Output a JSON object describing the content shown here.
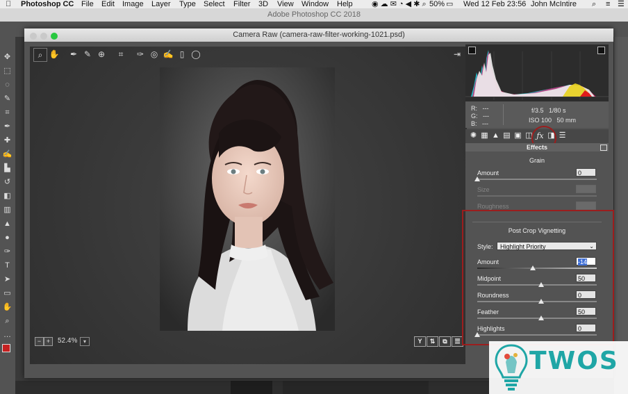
{
  "menubar": {
    "app": "Photoshop CC",
    "items": [
      "File",
      "Edit",
      "Image",
      "Layer",
      "Type",
      "Select",
      "Filter",
      "3D",
      "View",
      "Window",
      "Help"
    ],
    "battery": "50%",
    "datetime": "Wed 12 Feb  23:56",
    "user": "John McIntire"
  },
  "photoshop": {
    "title": "Adobe Photoshop CC 2018"
  },
  "camera_raw": {
    "title": "Camera Raw (camera-raw-filter-working-1021.psd)",
    "tools": [
      "zoom-icon",
      "hand-icon",
      "white-balance-icon",
      "color-sampler-icon",
      "targeted-adjust-icon",
      "crop-icon",
      "spot-removal-icon",
      "red-eye-icon",
      "adjustment-brush-icon",
      "graduated-filter-icon",
      "radial-filter-icon"
    ],
    "zoom": "52.4%",
    "status_buttons": [
      "Y",
      "⇅",
      "⧉",
      "☰"
    ]
  },
  "histogram": {
    "colors": {
      "shadow_clip": "#111111",
      "highlight_clip": "#111111"
    }
  },
  "readout": {
    "r_label": "R:",
    "r_value": "---",
    "g_label": "G:",
    "g_value": "---",
    "b_label": "B:",
    "b_value": "---",
    "aperture": "f/3.5",
    "shutter": "1/80 s",
    "iso": "ISO 100",
    "focal": "50 mm"
  },
  "panel": {
    "title": "Effects",
    "grain": {
      "title": "Grain",
      "amount_label": "Amount",
      "amount_value": "0",
      "size_label": "Size",
      "size_value": "",
      "roughness_label": "Roughness",
      "roughness_value": ""
    },
    "vignetting": {
      "title": "Post Crop Vignetting",
      "style_label": "Style:",
      "style_value": "Highlight Priority",
      "amount_label": "Amount",
      "amount_value": "-14",
      "midpoint_label": "Midpoint",
      "midpoint_value": "50",
      "roundness_label": "Roundness",
      "roundness_value": "0",
      "feather_label": "Feather",
      "feather_value": "50",
      "highlights_label": "Highlights",
      "highlights_value": "0"
    }
  },
  "watermark": {
    "text": "TWOS"
  },
  "colors": {
    "accent_marker": "#9c1d1d",
    "watermark": "#1fa6a6"
  }
}
